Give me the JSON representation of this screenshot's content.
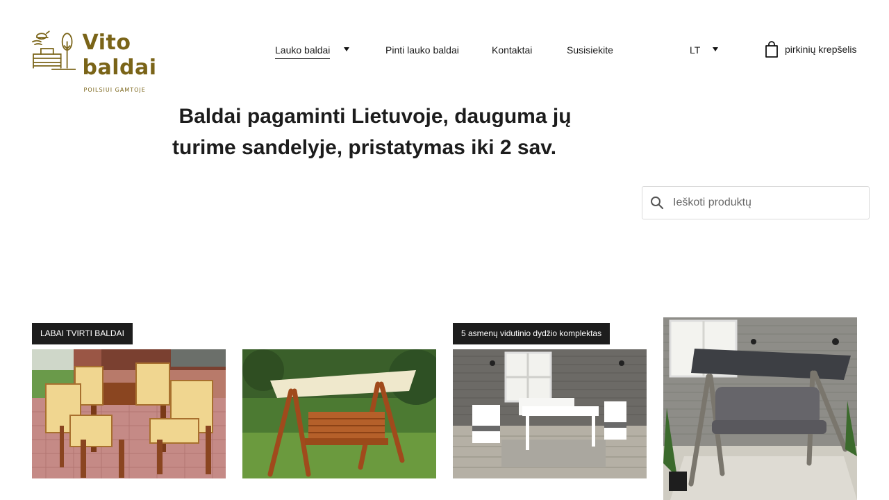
{
  "brand": {
    "name": "Vito baldai",
    "tagline": "POILSIUI GAMTOJE",
    "color": "#7a6418"
  },
  "nav": {
    "items": [
      {
        "label": "Lauko baldai",
        "active": true,
        "has_dropdown": true
      },
      {
        "label": "Pinti lauko baldai"
      },
      {
        "label": "Kontaktai"
      },
      {
        "label": "Susisiekite"
      }
    ],
    "language": "LT",
    "cart_label": "pirkinių krepšelis"
  },
  "hero": {
    "line1": "Baldai pagaminti Lietuvoje, dauguma jų",
    "line2": "turime sandelyje, pristatymas iki 2 sav."
  },
  "search": {
    "placeholder": "Ieškoti produktų"
  },
  "products": [
    {
      "badge": "LABAI TVIRTI BALDAI",
      "image": "wooden-dining-set-with-cushions"
    },
    {
      "badge": "",
      "image": "wooden-garden-swing-with-canopy"
    },
    {
      "badge": "5 asmenų vidutinio dydžio komplektas",
      "image": "white-patio-furniture-set"
    },
    {
      "badge": "",
      "image": "grey-garden-swing-with-canopy"
    }
  ]
}
